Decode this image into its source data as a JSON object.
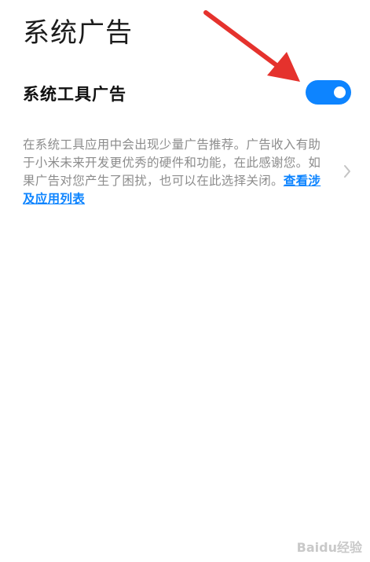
{
  "page": {
    "title": "系统广告"
  },
  "setting": {
    "label": "系统工具广告",
    "enabled": true
  },
  "description": {
    "text": "在系统工具应用中会出现少量广告推荐。广告收入有助于小米未来开发更优秀的硬件和功能，在此感谢您。如果广告对您产生了困扰，也可以在此选择关闭。",
    "link_label": "查看涉及应用列表"
  },
  "icons": {
    "chevron": "chevron-right-icon",
    "arrow": "red-annotation-arrow"
  },
  "watermark": {
    "text": "Baidu经验"
  },
  "colors": {
    "accent": "#0d84ff",
    "arrow": "#e5322d"
  }
}
